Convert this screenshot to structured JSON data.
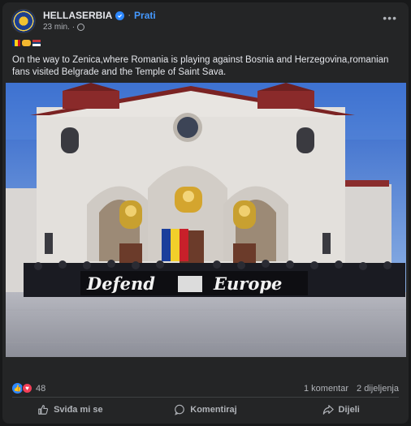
{
  "post": {
    "page_name": "HELLASERBIA",
    "follow_label": "Prati",
    "separator": "·",
    "time": "23 min.",
    "meta_separator": "·",
    "caption": "On the way to Zenica,where Romania is playing against Bosnia and Herzegovina,romanian fans visited Belgrade and the Temple of Saint Sava.",
    "photo": {
      "banner_text_left": "Defend",
      "banner_text_right": "Europe"
    }
  },
  "footer": {
    "reaction_count": "48",
    "comments": "1 komentar",
    "shares": "2 dijeljenja",
    "like_label": "Sviđa mi se",
    "comment_label": "Komentiraj",
    "share_label": "Dijeli"
  },
  "colors": {
    "accent": "#4599ff",
    "card_bg": "#242526",
    "page_bg": "#18191a"
  },
  "icons": [
    "verified-badge-icon",
    "globe-icon",
    "more-options-icon",
    "like-reaction-icon",
    "love-reaction-icon",
    "thumbs-up-icon",
    "comment-icon",
    "share-icon"
  ]
}
